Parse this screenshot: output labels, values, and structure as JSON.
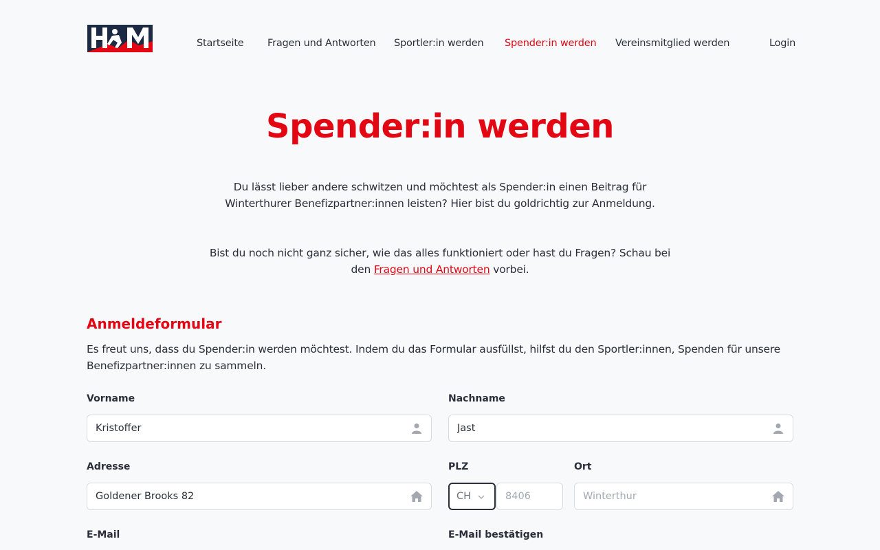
{
  "logo": {
    "text": "HSM",
    "brand_color": "#e30613",
    "dark_color": "#1d2a44"
  },
  "nav": {
    "items": [
      {
        "label": "Startseite"
      },
      {
        "label": "Fragen und Antworten"
      },
      {
        "label": "Sportler:in werden"
      },
      {
        "label": "Spender:in werden",
        "active": true
      },
      {
        "label": "Vereinsmitglied werden"
      }
    ],
    "login_label": "Login"
  },
  "hero": {
    "title": "Spender:in werden",
    "intro_line1": "Du lässt lieber andere schwitzen und möchtest als Spender:in einen Beitrag für",
    "intro_line2": "Winterthurer Benefizpartner:innen leisten? Hier bist du goldrichtig zur Anmeldung.",
    "faq_line1": "Bist du noch nicht ganz sicher, wie das alles funktioniert oder hast du Fragen? Schau bei",
    "faq_prefix": "den",
    "faq_link": "Fragen und Antworten",
    "faq_suffix": "vorbei."
  },
  "form": {
    "title": "Anmeldeformular",
    "description": "Es freut uns, dass du Spender:in werden möchtest. Indem du das Formular ausfüllst, hilfst du den Sportler:innen, Spenden für unsere Benefizpartner:innen zu sammeln.",
    "vorname": {
      "label": "Vorname",
      "value": "Kristoffer",
      "icon": "person-icon"
    },
    "nachname": {
      "label": "Nachname",
      "value": "Jast",
      "icon": "person-icon"
    },
    "adresse": {
      "label": "Adresse",
      "value": "Goldener Brooks 82",
      "icon": "home-icon"
    },
    "plz": {
      "label": "PLZ",
      "country": "CH",
      "placeholder": "8406"
    },
    "ort": {
      "label": "Ort",
      "placeholder": "Winterthur",
      "icon": "home-icon"
    },
    "email": {
      "label": "E-Mail"
    },
    "email_confirm": {
      "label": "E-Mail bestätigen"
    }
  },
  "colors": {
    "accent": "#e30613",
    "text": "#2a2f3a",
    "background": "#f8f9fb"
  }
}
